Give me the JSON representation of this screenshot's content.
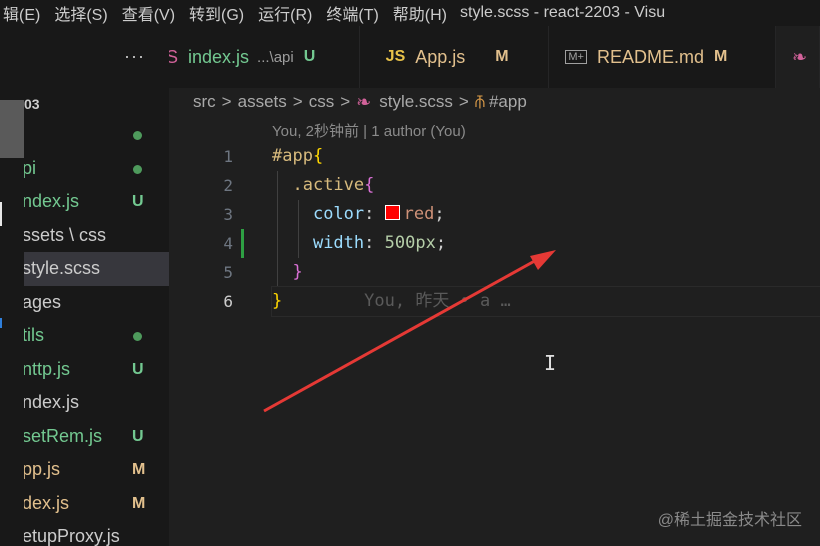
{
  "menubar": {
    "items": [
      "辑(E)",
      "选择(S)",
      "查看(V)",
      "转到(G)",
      "运行(R)",
      "终端(T)",
      "帮助(H)"
    ],
    "window_title": "style.scss - react-2203 - Visu"
  },
  "sidebar": {
    "more": "···",
    "project": "03",
    "rows": [
      {
        "label": "",
        "status": "dot"
      },
      {
        "label": "pi",
        "status": "dot"
      },
      {
        "label": "ndex.js",
        "status": "U"
      },
      {
        "label": "ssets \\ css",
        "status": ""
      },
      {
        "label": "style.scss",
        "status": "",
        "selected": true
      },
      {
        "label": "ages",
        "status": ""
      },
      {
        "label": "tils",
        "status": "dot"
      },
      {
        "label": "nttp.js",
        "status": "U"
      },
      {
        "label": "ndex.js",
        "status": ""
      },
      {
        "label": "setRem.js",
        "status": "U"
      },
      {
        "label": "pp.js",
        "status": "M"
      },
      {
        "label": "dex.js",
        "status": "M"
      },
      {
        "label": "etupProxy.js",
        "status": ""
      }
    ]
  },
  "tabs": [
    {
      "icon": "S",
      "label": "index.js",
      "desc": "...\\api",
      "status": "U"
    },
    {
      "icon": "JS",
      "label": "App.js",
      "desc": "",
      "status": "M"
    },
    {
      "icon": "M+",
      "label": "README.md",
      "desc": "",
      "status": "M"
    },
    {
      "icon": "sass-icon",
      "label": "",
      "desc": "",
      "status": ""
    }
  ],
  "breadcrumb": [
    "src",
    "assets",
    "css",
    "style.scss",
    "#app"
  ],
  "codelens": "You, 2秒钟前 | 1 author (You)",
  "line_numbers": [
    "1",
    "2",
    "3",
    "4",
    "5",
    "6"
  ],
  "code": {
    "l1_sel": "#app",
    "l1_br": "{",
    "l2_sel": ".active",
    "l2_br": "{",
    "l3_prop": "color",
    "l3_val": "red",
    "l4_prop": "width",
    "l4_val": "500px",
    "l5_br": "}",
    "l6_br": "}",
    "blame": "You, 昨天 • a …"
  },
  "colors": {
    "swatch": "#ff0000",
    "arrow": "#e53935"
  },
  "watermark": "@稀土掘金技术社区"
}
